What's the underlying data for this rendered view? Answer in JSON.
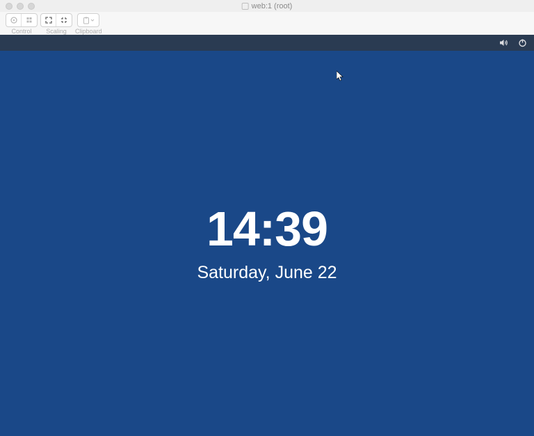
{
  "window": {
    "title": "web:1 (root)"
  },
  "toolbar": {
    "control_label": "Control",
    "scaling_label": "Scaling",
    "clipboard_label": "Clipboard"
  },
  "topbar": {
    "volume_icon": "volume-icon",
    "power_icon": "power-icon"
  },
  "lockscreen": {
    "time": "14:39",
    "date": "Saturday, June 22"
  }
}
